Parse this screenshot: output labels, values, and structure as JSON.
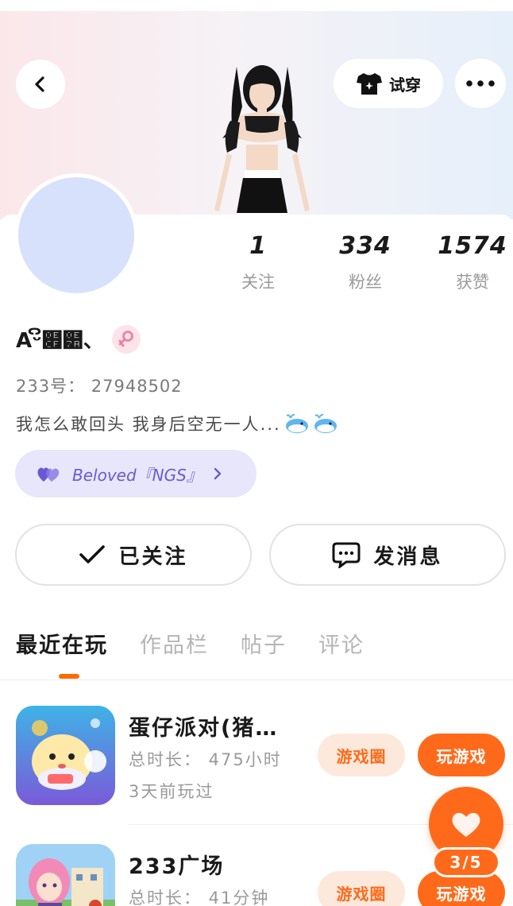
{
  "header": {
    "try_on_label": "试穿",
    "try_on_icon": "tshirt-sparkle-icon",
    "back_icon": "chevron-left-icon",
    "more_icon": "more-dots-icon"
  },
  "profile": {
    "stats": [
      {
        "value": "1",
        "label": "关注"
      },
      {
        "value": "334",
        "label": "粉丝"
      },
      {
        "value": "1574",
        "label": "获赞"
      }
    ],
    "nickname": "Aᵕິ໏๺、",
    "gender": "female",
    "user_id": "233号：  27948502",
    "bio": "我怎么敢回头 我身后空无一人...",
    "fan_tag": "Beloved『NGS』"
  },
  "actions": {
    "follow_label": "已关注",
    "message_label": "发消息"
  },
  "tabs": [
    {
      "label": "最近在玩",
      "active": true
    },
    {
      "label": "作品栏",
      "active": false
    },
    {
      "label": "帖子",
      "active": false
    },
    {
      "label": "评论",
      "active": false
    }
  ],
  "games": [
    {
      "title": "蛋仔派对(猪…",
      "play_time": "总时长：  475小时",
      "last_played": "3天前玩过",
      "circle_label": "游戏圈",
      "play_label": "玩游戏"
    },
    {
      "title": "233广场",
      "play_time": "总时长：  41分钟",
      "circle_label": "游戏圈",
      "play_label": "玩游戏"
    }
  ],
  "floating": {
    "counter": "3/5",
    "icon": "heart-icon"
  },
  "colors": {
    "accent": "#ff6a1a",
    "avatar_placeholder": "#d7e1fb",
    "fan_tag_bg": "#e8e6fb",
    "fan_tag_text": "#6b58d6"
  }
}
